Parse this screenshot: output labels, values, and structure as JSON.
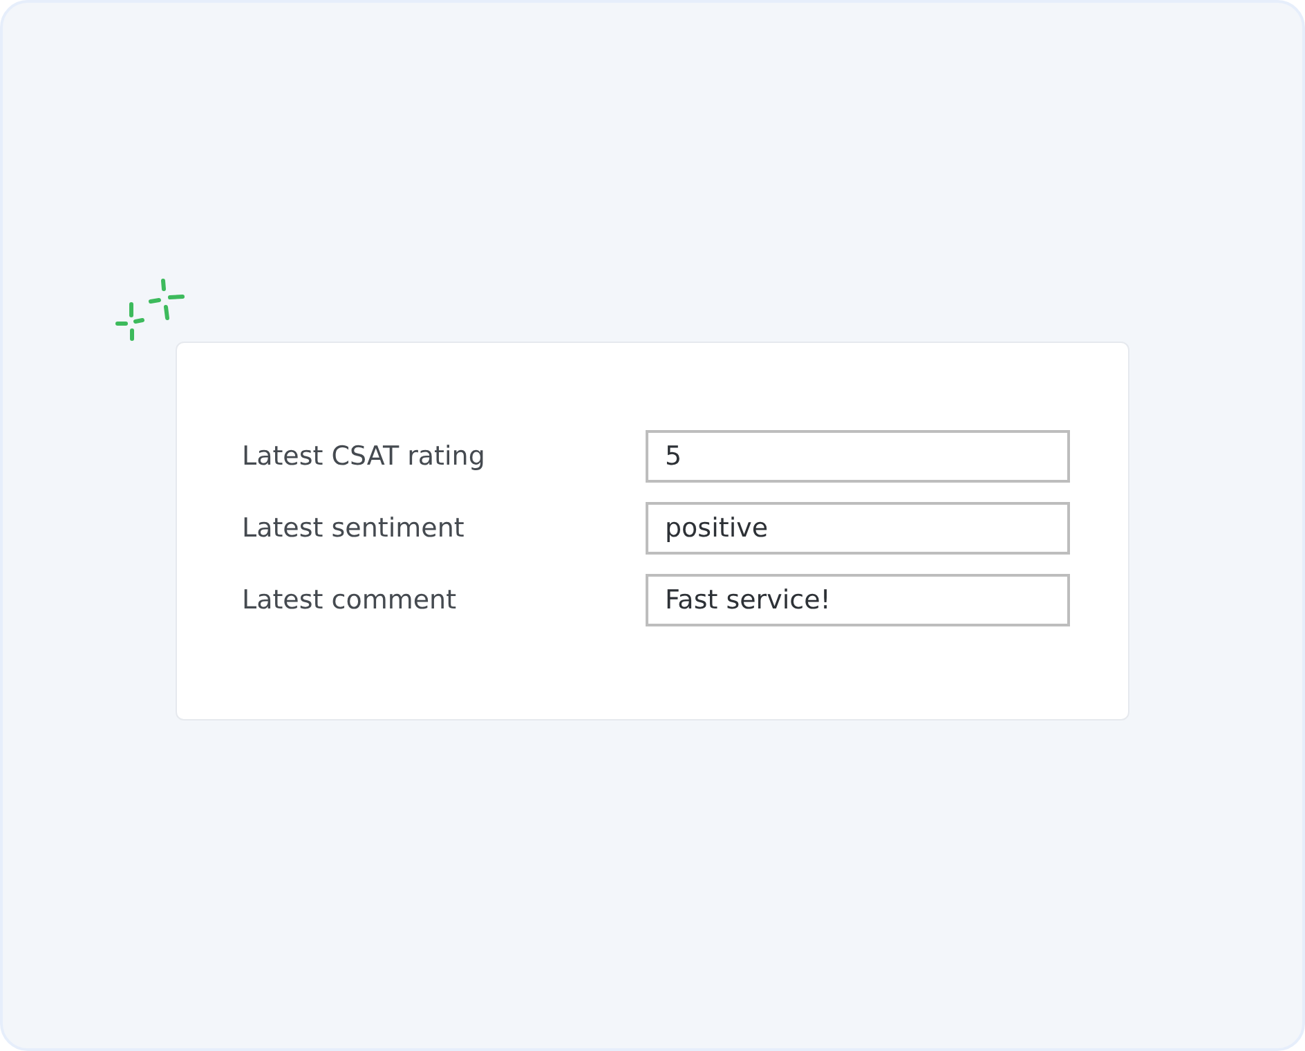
{
  "fields": [
    {
      "label": "Latest CSAT rating",
      "value": "5"
    },
    {
      "label": "Latest sentiment",
      "value": "positive"
    },
    {
      "label": "Latest comment",
      "value": "Fast service!"
    }
  ]
}
